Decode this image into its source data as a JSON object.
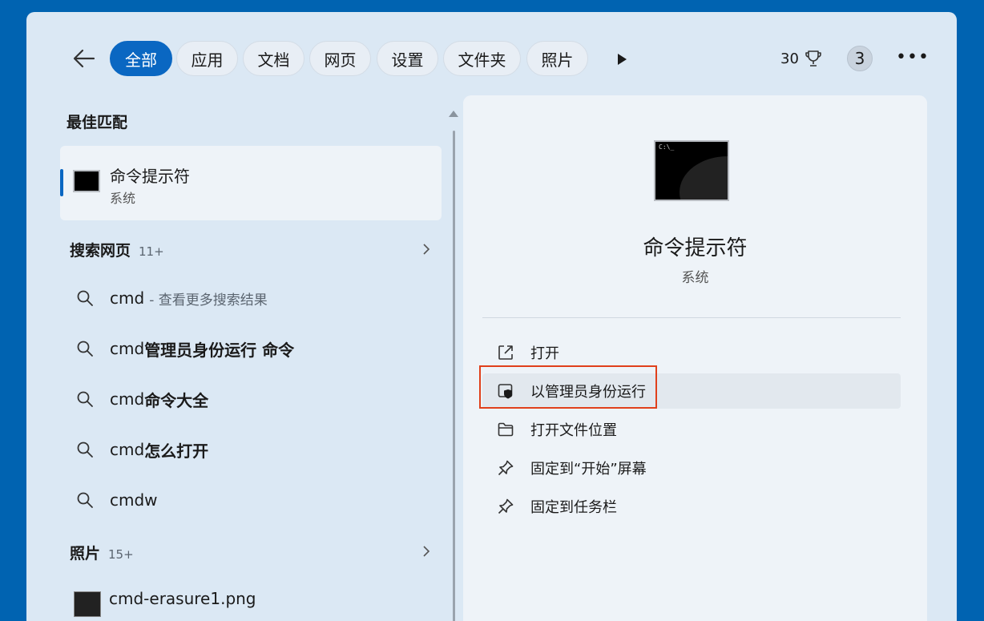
{
  "tabs": [
    {
      "label": "全部",
      "active": true
    },
    {
      "label": "应用"
    },
    {
      "label": "文档"
    },
    {
      "label": "网页"
    },
    {
      "label": "设置"
    },
    {
      "label": "文件夹"
    },
    {
      "label": "照片"
    }
  ],
  "header": {
    "points": "30",
    "badge": "3",
    "more": "•••"
  },
  "best_match": {
    "heading": "最佳匹配",
    "title": "命令提示符",
    "subtitle": "系统",
    "icon_text": "C:\\_"
  },
  "web": {
    "heading": "搜索网页",
    "count": "11+",
    "items": [
      {
        "pre": "cmd",
        "bold": "",
        "dim": "- 查看更多搜索结果"
      },
      {
        "pre": "cmd",
        "bold": "管理员身份运行 命令",
        "dim": ""
      },
      {
        "pre": "cmd",
        "bold": "命令大全",
        "dim": ""
      },
      {
        "pre": "cmd",
        "bold": "怎么打开",
        "dim": ""
      },
      {
        "pre": "cmdw",
        "bold": "",
        "dim": ""
      }
    ]
  },
  "photos": {
    "heading": "照片",
    "count": "15+",
    "first": "cmd-erasure1.png"
  },
  "detail": {
    "title": "命令提示符",
    "subtitle": "系统",
    "actions": [
      {
        "label": "打开",
        "icon": "open-external-icon"
      },
      {
        "label": "以管理员身份运行",
        "icon": "admin-shield-icon"
      },
      {
        "label": "打开文件位置",
        "icon": "folder-icon"
      },
      {
        "label": "固定到“开始”屏幕",
        "icon": "pin-icon"
      },
      {
        "label": "固定到任务栏",
        "icon": "pin-icon"
      }
    ]
  },
  "colors": {
    "accent": "#0a67c2",
    "highlight_box": "#e0401b",
    "background": "#0063b1"
  }
}
